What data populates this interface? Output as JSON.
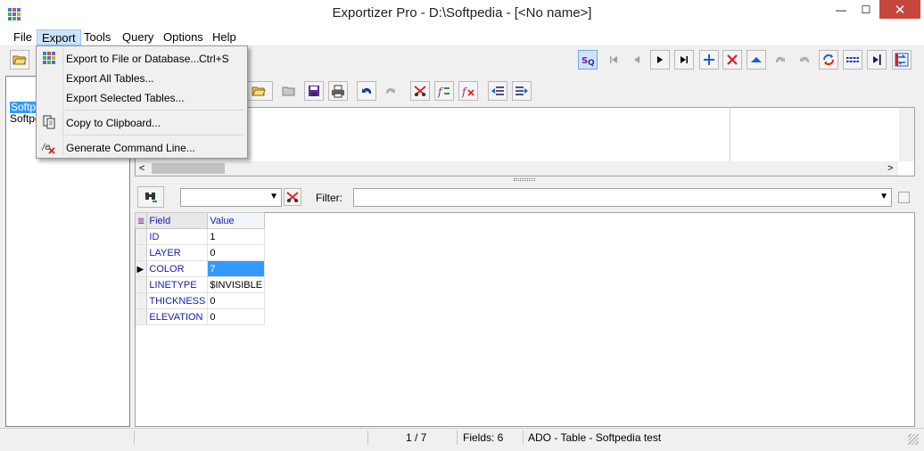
{
  "window": {
    "title": "Exportizer Pro - D:\\Softpedia - [<No name>]",
    "minimize": "—",
    "maximize": "☐",
    "close": "✕"
  },
  "menubar": {
    "items": [
      "File",
      "Export",
      "Tools",
      "Query",
      "Options",
      "Help"
    ]
  },
  "export_menu": {
    "items": [
      {
        "label": "Export to File or Database...",
        "shortcut": "Ctrl+S",
        "icon": "export-grid-icon"
      },
      {
        "label": "Export All Tables...",
        "icon": ""
      },
      {
        "label": "Export Selected Tables...",
        "icon": ""
      },
      {
        "label": "Copy to Clipboard...",
        "icon": "clipboard-icon"
      },
      {
        "label": "Generate Command Line...",
        "icon": "command-line-icon"
      }
    ]
  },
  "tree": {
    "items": [
      "Softpe",
      "Softpe"
    ]
  },
  "filter": {
    "label": "Filter:",
    "value": ""
  },
  "grid": {
    "headers": [
      "Field",
      "Value"
    ],
    "rows": [
      {
        "field": "ID",
        "value": "1"
      },
      {
        "field": "LAYER",
        "value": "0"
      },
      {
        "field": "COLOR",
        "value": "7"
      },
      {
        "field": "LINETYPE",
        "value": "$INVISIBLE"
      },
      {
        "field": "THICKNESS",
        "value": "0"
      },
      {
        "field": "ELEVATION",
        "value": "0"
      }
    ],
    "current_row": 2
  },
  "statusbar": {
    "record": "1 / 7",
    "fields": "Fields: 6",
    "info": "ADO - Table - Softpedia test"
  },
  "colors": {
    "accent": "#3399ff",
    "menu_highlight": "#cce4f7",
    "close_button": "#c7463c",
    "field_text": "#1a1aa6"
  }
}
